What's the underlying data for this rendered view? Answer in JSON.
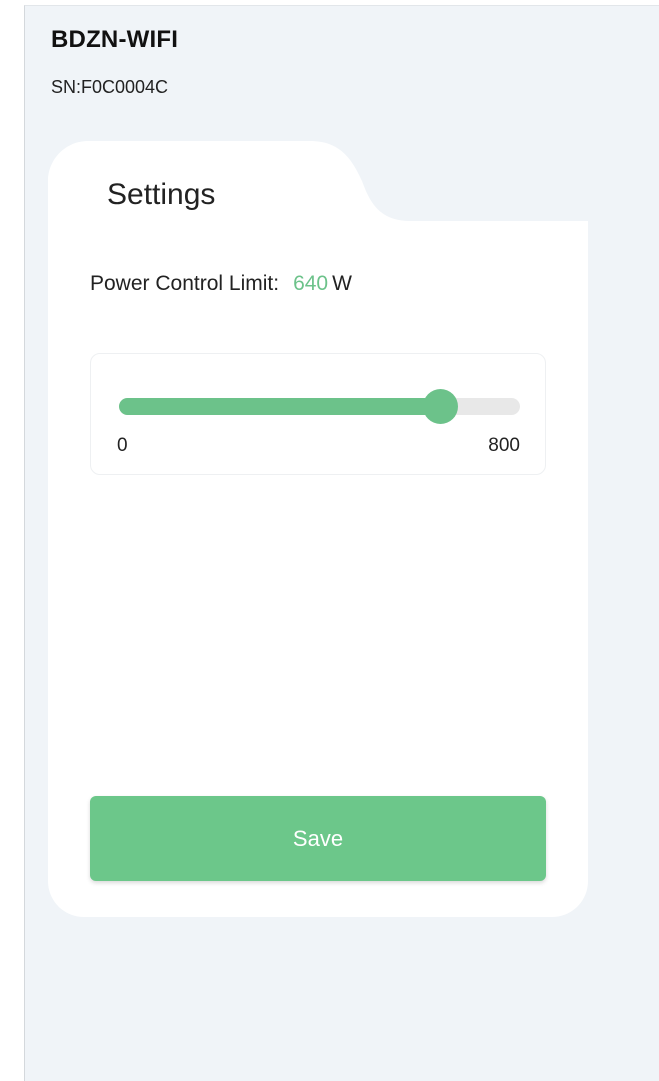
{
  "header": {
    "device_name": "BDZN-WIFI",
    "serial": "SN:F0C0004C"
  },
  "settings": {
    "tab_title": "Settings",
    "limit_label": "Power Control Limit:",
    "limit_value": "640",
    "limit_unit": "W",
    "slider": {
      "min_label": "0",
      "max_label": "800",
      "min": 0,
      "max": 800,
      "value": 640
    },
    "save_label": "Save"
  },
  "colors": {
    "accent": "#6cc28a",
    "background": "#f0f4f8",
    "card": "#ffffff"
  }
}
